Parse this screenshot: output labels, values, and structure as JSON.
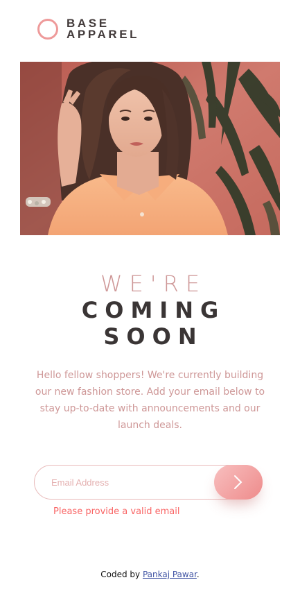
{
  "brand": {
    "line1": "BASE",
    "line2": "APPAREL",
    "accent_color": "#ee9a9a",
    "text_color": "#423a3a"
  },
  "hero": {
    "icon": "model-photo"
  },
  "heading": {
    "light": "WE'RE",
    "bold_line1": "COMING",
    "bold_line2": "SOON"
  },
  "description": "Hello fellow shoppers! We're currently building our new fashion store. Add your email below to stay up-to-date with announcements and our launch deals.",
  "form": {
    "email_placeholder": "Email Address",
    "email_value": "",
    "submit_icon": "chevron-right-icon",
    "error_text": "Please provide a valid email",
    "error_color": "#f96464"
  },
  "footer": {
    "prefix": "Coded by",
    "author": "Pankaj Pawar",
    "suffix": "."
  }
}
